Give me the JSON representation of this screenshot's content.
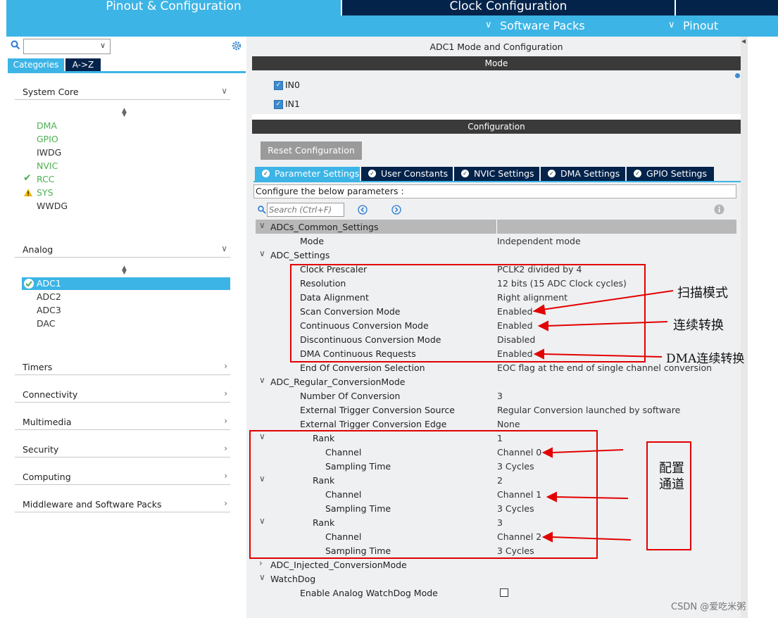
{
  "top_tabs": {
    "pinout": "Pinout & Configuration",
    "clock": "Clock Configuration"
  },
  "sub_menu": {
    "software_packs": "Software Packs",
    "pinout": "Pinout"
  },
  "left": {
    "tabs": {
      "categories": "Categories",
      "az": "A->Z"
    },
    "system_core": {
      "label": "System Core",
      "items": [
        "DMA",
        "GPIO",
        "IWDG",
        "NVIC",
        "RCC",
        "SYS",
        "WWDG"
      ]
    },
    "analog": {
      "label": "Analog",
      "items": [
        "ADC1",
        "ADC2",
        "ADC3",
        "DAC"
      ]
    },
    "groups": [
      "Timers",
      "Connectivity",
      "Multimedia",
      "Security",
      "Computing",
      "Middleware and Software Packs"
    ]
  },
  "right": {
    "title": "ADC1 Mode and Configuration",
    "mode_header": "Mode",
    "mode_items": [
      "IN0",
      "IN1"
    ],
    "config_header": "Configuration",
    "reset_button": "Reset Configuration",
    "tabs": [
      "Parameter Settings",
      "User Constants",
      "NVIC Settings",
      "DMA Settings",
      "GPIO Settings"
    ],
    "configure_text": "Configure the below parameters :",
    "search_placeholder": "Search (Ctrl+F)",
    "params": [
      {
        "k": "ADCs_Common_Settings",
        "v": ""
      },
      {
        "k": "Mode",
        "v": "Independent mode"
      },
      {
        "k": "ADC_Settings",
        "v": ""
      },
      {
        "k": "Clock Prescaler",
        "v": "PCLK2 divided by 4"
      },
      {
        "k": "Resolution",
        "v": "12 bits (15 ADC Clock cycles)"
      },
      {
        "k": "Data Alignment",
        "v": "Right alignment"
      },
      {
        "k": "Scan Conversion Mode",
        "v": "Enabled"
      },
      {
        "k": "Continuous Conversion Mode",
        "v": "Enabled"
      },
      {
        "k": "Discontinuous Conversion Mode",
        "v": "Disabled"
      },
      {
        "k": "DMA Continuous Requests",
        "v": "Enabled"
      },
      {
        "k": "End Of Conversion Selection",
        "v": "EOC flag at the end of single channel conversion"
      },
      {
        "k": "ADC_Regular_ConversionMode",
        "v": ""
      },
      {
        "k": "Number Of Conversion",
        "v": "3"
      },
      {
        "k": "External Trigger Conversion Source",
        "v": "Regular Conversion launched by software"
      },
      {
        "k": "External Trigger Conversion Edge",
        "v": "None"
      },
      {
        "k": "Rank",
        "v": "1"
      },
      {
        "k": "Channel",
        "v": "Channel 0"
      },
      {
        "k": "Sampling Time",
        "v": "3 Cycles"
      },
      {
        "k": "Rank",
        "v": "2"
      },
      {
        "k": "Channel",
        "v": "Channel 1"
      },
      {
        "k": "Sampling Time",
        "v": "3 Cycles"
      },
      {
        "k": "Rank",
        "v": "3"
      },
      {
        "k": "Channel",
        "v": "Channel 2"
      },
      {
        "k": "Sampling Time",
        "v": "3 Cycles"
      },
      {
        "k": "ADC_Injected_ConversionMode",
        "v": ""
      },
      {
        "k": "WatchDog",
        "v": ""
      },
      {
        "k": "Enable Analog WatchDog Mode",
        "v": ""
      }
    ]
  },
  "annotations": {
    "scan": "扫描模式",
    "continuous": "连续转换",
    "dma": "DMA连续转换",
    "channels_l1": "配置",
    "channels_l2": "通道"
  },
  "watermark": "CSDN @爱吃米粥",
  "colors": {
    "accent_blue": "#3cb4e6",
    "dark_navy": "#03234b",
    "annotation_red": "#e30000",
    "enabled_green": "#4db04f",
    "warning_yellow": "#f5b800"
  }
}
